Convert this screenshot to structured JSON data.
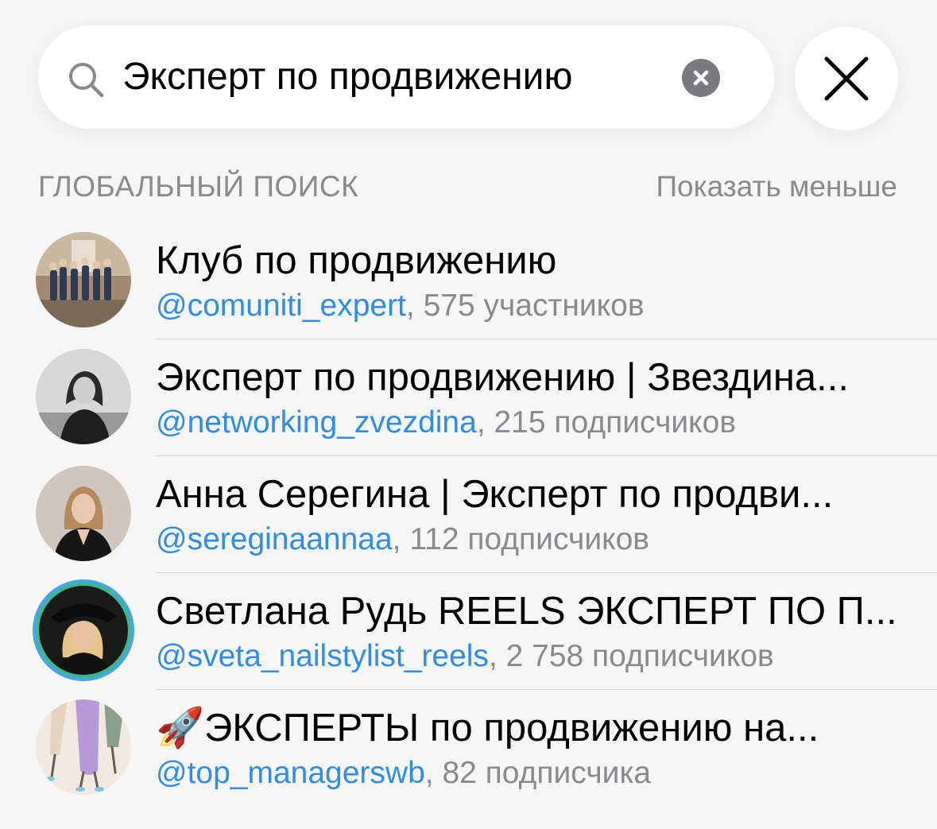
{
  "search": {
    "query": "Эксперт по продвижению"
  },
  "section": {
    "title": "ГЛОБАЛЬНЫЙ ПОИСК",
    "action": "Показать меньше"
  },
  "results": [
    {
      "title": "Клуб по продвижению",
      "handle": "@comuniti_expert",
      "meta": ", 575 участников"
    },
    {
      "title": "Эксперт по продвижению | Звездина...",
      "handle": "@networking_zvezdina",
      "meta": ", 215 подписчиков"
    },
    {
      "title": "Анна Серегина | Эксперт по продви...",
      "handle": "@sereginaannaa",
      "meta": ", 112 подписчиков"
    },
    {
      "title": "Светлана Рудь REELS ЭКСПЕРТ ПО П...",
      "handle": "@sveta_nailstylist_reels",
      "meta": ", 2 758 подписчиков"
    },
    {
      "title": "🚀ЭКСПЕРТЫ по продвижению на...",
      "handle": "@top_managerswb",
      "meta": ", 82 подписчика"
    }
  ],
  "colors": {
    "handle": "#2f8ce8",
    "secondary_text": "#8a8a8e",
    "background": "#f6f6f6"
  }
}
